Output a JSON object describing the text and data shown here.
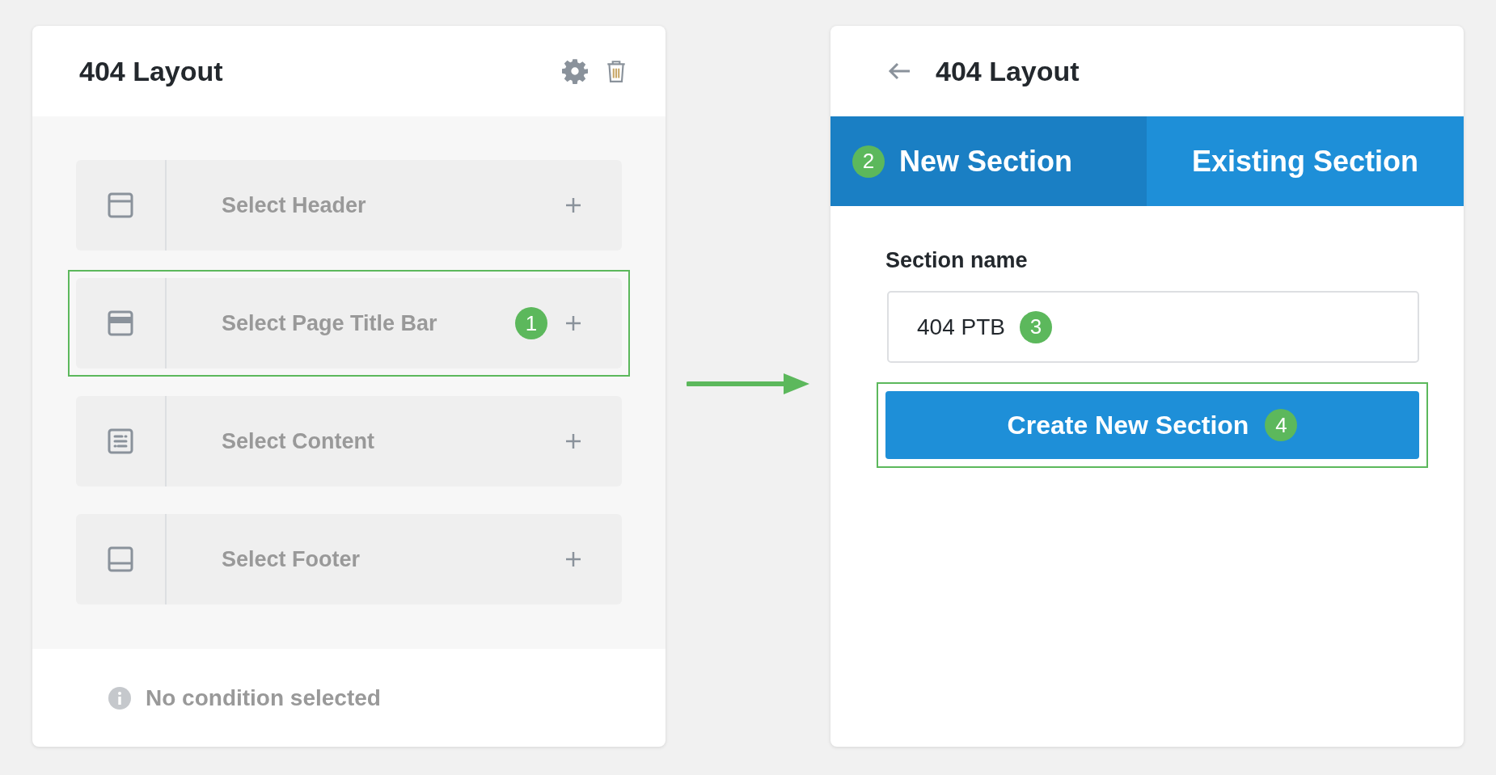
{
  "layout_panel": {
    "title": "404 Layout",
    "rows": [
      {
        "kind": "header",
        "label": "Select Header",
        "highlighted": false
      },
      {
        "kind": "title-bar",
        "label": "Select Page Title Bar",
        "highlighted": true,
        "badge": "1"
      },
      {
        "kind": "content",
        "label": "Select Content",
        "highlighted": false
      },
      {
        "kind": "footer",
        "label": "Select Footer",
        "highlighted": false
      }
    ],
    "footer": "No condition selected"
  },
  "section_panel": {
    "title": "404 Layout",
    "tabs": [
      {
        "label": "New Section",
        "selected": true,
        "badge": "2"
      },
      {
        "label": "Existing Section",
        "selected": false
      }
    ],
    "field_label": "Section name",
    "field_value": "404 PTB",
    "field_badge": "3",
    "button": {
      "label": "Create New Section",
      "badge": "4",
      "highlighted": true
    }
  }
}
